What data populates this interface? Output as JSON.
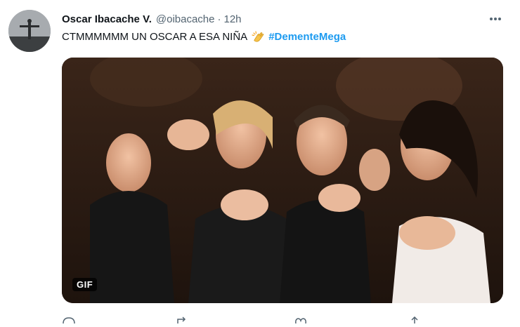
{
  "tweet": {
    "author_name": "Oscar Ibacache V.",
    "handle": "@oibacache",
    "separator": "·",
    "time": "12h",
    "text": "CTMMMMMM UN OSCAR A ESA NIÑA",
    "emoji": "clapping-hands-icon",
    "hashtag": "#DementeMega",
    "gif_badge": "GIF"
  },
  "colors": {
    "link": "#1d9bf0",
    "secondary_text": "#536471",
    "primary_text": "#0f1419"
  },
  "icons": [
    "more-options-icon",
    "clapping-hands-icon",
    "reply-icon",
    "retweet-icon",
    "like-icon",
    "share-icon"
  ]
}
